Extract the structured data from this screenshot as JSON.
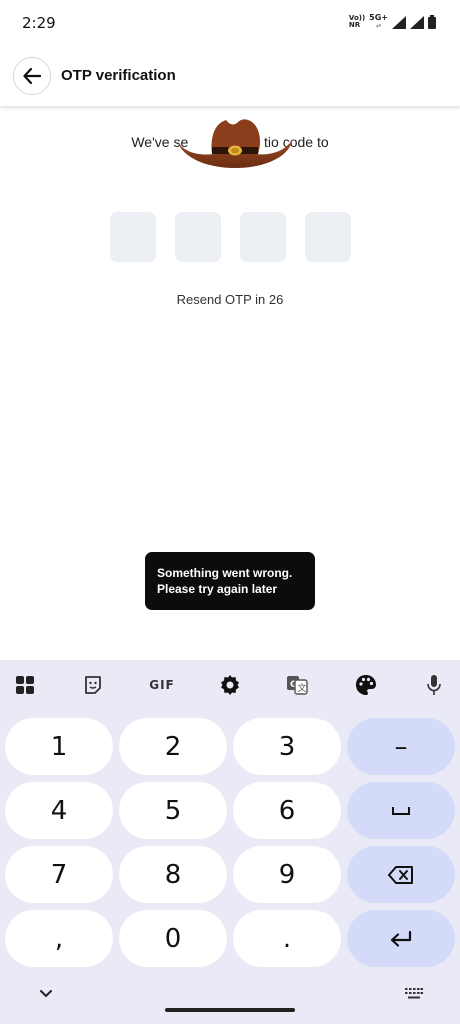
{
  "status_bar": {
    "time": "2:29",
    "network_label_top": "Vo))",
    "network_label_bottom": "NR",
    "network_type": "5G+"
  },
  "app_bar": {
    "title": "OTP verification",
    "back_icon": "arrow-left-icon"
  },
  "content": {
    "sent_text_left": "We've se",
    "sent_text_mid": "tio",
    "sent_text_right": "code to",
    "otp_boxes": [
      "",
      "",
      "",
      ""
    ],
    "resend_text": "Resend OTP in 26"
  },
  "toast": {
    "line1": "Something went wrong.",
    "line2": "Please try again later"
  },
  "keyboard": {
    "toolbar": {
      "gif_label": "GIF",
      "icons": [
        "apps-grid-icon",
        "sticker-icon",
        "gif-icon",
        "settings-gear-icon",
        "translate-icon",
        "palette-icon",
        "microphone-icon"
      ]
    },
    "keys": {
      "k1": "1",
      "k2": "2",
      "k3": "3",
      "dash": "–",
      "k4": "4",
      "k5": "5",
      "k6": "6",
      "space": "␣",
      "k7": "7",
      "k8": "8",
      "k9": "9",
      "comma": ",",
      "k0": "0",
      "period": "."
    },
    "colors": {
      "background": "#e9eaf5",
      "key": "#ffffff",
      "function_key": "#d3dbf8"
    }
  }
}
